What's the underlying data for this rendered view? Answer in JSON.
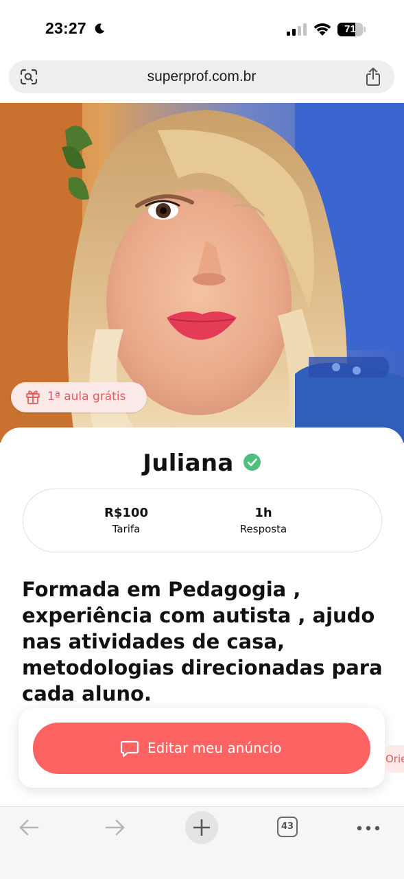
{
  "status_bar": {
    "time": "23:27",
    "battery": "71",
    "battery_level": 0.71
  },
  "browser": {
    "url": "superprof.com.br",
    "tab_count": "43"
  },
  "profile": {
    "trial_badge": "1ª aula grátis",
    "name": "Juliana",
    "stats": [
      {
        "value": "R$100",
        "label": "Tarifa"
      },
      {
        "value": "1h",
        "label": "Resposta"
      }
    ],
    "headline": "Formada em Pedagogia , experiência com autista , ajudo nas atividades de casa, metodologias direcionadas para cada aluno."
  },
  "cta": {
    "label": "Editar meu anúncio",
    "peek_label": "Orie"
  },
  "icons": {
    "moon": "moon-icon",
    "signal": "cellular-signal-icon",
    "wifi": "wifi-icon",
    "lens": "screenshot-lens-icon",
    "share": "share-icon",
    "gift": "gift-icon",
    "verified": "verified-check-icon",
    "chat": "chat-bubble-icon",
    "back": "arrow-left-icon",
    "forward": "arrow-right-icon",
    "plus": "plus-icon",
    "more": "more-dots-icon"
  },
  "colors": {
    "accent": "#fd6362",
    "badge_bg": "#fbe9e8",
    "badge_text": "#e5595a",
    "verified": "#4fbf7f"
  }
}
